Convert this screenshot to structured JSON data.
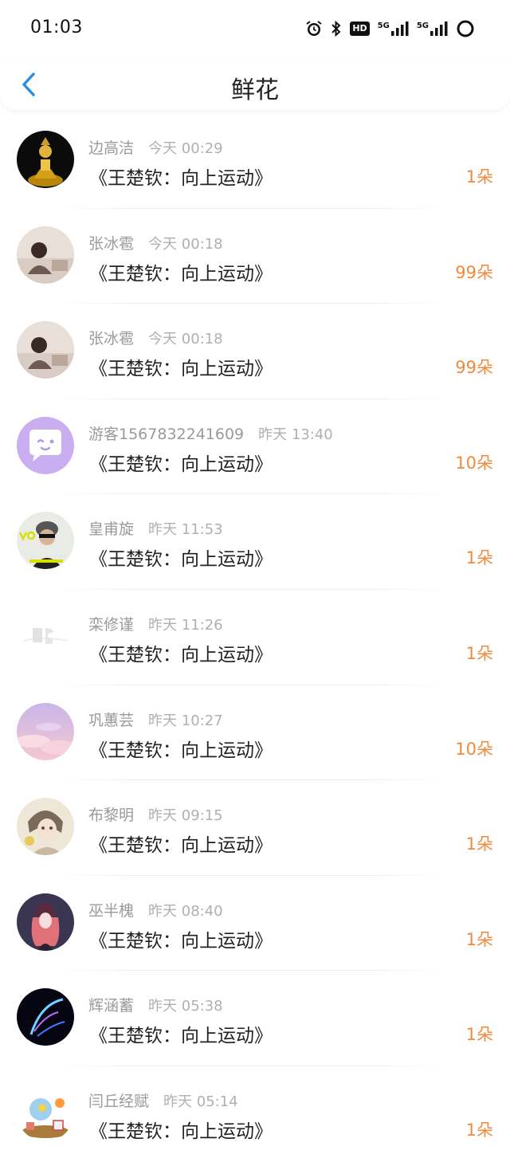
{
  "status_bar": {
    "time": "01:03",
    "hd_label": "HD",
    "sim1_label": "5G",
    "sim2_label": "5G"
  },
  "header": {
    "title": "鲜花"
  },
  "colors": {
    "accent": "#2b8fe0",
    "count": "#f08a3c"
  },
  "gifts": [
    {
      "name": "边高洁",
      "time": "今天 00:29",
      "book": "《王楚钦：向上运动》",
      "count": "1朵",
      "avatar": "golden-statue"
    },
    {
      "name": "张冰雹",
      "time": "今天 00:18",
      "book": "《王楚钦：向上运动》",
      "count": "99朵",
      "avatar": "person-photo"
    },
    {
      "name": "张冰雹",
      "time": "今天 00:18",
      "book": "《王楚钦：向上运动》",
      "count": "99朵",
      "avatar": "person-photo"
    },
    {
      "name": "游客1567832241609",
      "time": "昨天 13:40",
      "book": "《王楚钦：向上运动》",
      "count": "10朵",
      "avatar": "default-chat"
    },
    {
      "name": "皇甫旋",
      "time": "昨天 11:53",
      "book": "《王楚钦：向上运动》",
      "count": "1朵",
      "avatar": "sunglasses-man"
    },
    {
      "name": "栾修谨",
      "time": "昨天 11:26",
      "book": "《王楚钦：向上运动》",
      "count": "1朵",
      "avatar": "white-logo"
    },
    {
      "name": "巩蕙芸",
      "time": "昨天 10:27",
      "book": "《王楚钦：向上运动》",
      "count": "10朵",
      "avatar": "pink-sky"
    },
    {
      "name": "布黎明",
      "time": "昨天 09:15",
      "book": "《王楚钦：向上运动》",
      "count": "1朵",
      "avatar": "anime-boy"
    },
    {
      "name": "巫半槐",
      "time": "昨天 08:40",
      "book": "《王楚钦：向上运动》",
      "count": "1朵",
      "avatar": "anime-girl"
    },
    {
      "name": "辉涵蓄",
      "time": "昨天 05:38",
      "book": "《王楚钦：向上运动》",
      "count": "1朵",
      "avatar": "dark-feather"
    },
    {
      "name": "闫丘经赋",
      "time": "昨天 05:14",
      "book": "《王楚钦：向上运动》",
      "count": "1朵",
      "avatar": "cartoon-scene"
    }
  ]
}
